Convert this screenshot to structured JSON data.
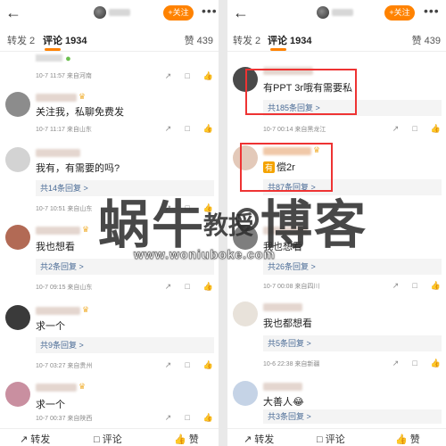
{
  "header": {
    "back_icon": "back-arrow-icon",
    "follow_label": "+关注",
    "more_icon": "more-dots-icon"
  },
  "tabs": {
    "repost": "转发 2",
    "comment": "评论 1934",
    "like": "赞 439"
  },
  "left": {
    "partial_top_meta": "10-7 11:57  来自河南",
    "comments": [
      {
        "text": "关注我，私聊免费发",
        "meta": "10-7 11:17  来自山东",
        "replies": ""
      },
      {
        "text": "我有，有需要的吗?",
        "meta": "10-7 10:51  来自山东",
        "replies": "共14条回复 >"
      },
      {
        "text": "我也想看",
        "meta": "10-7 09:15  来自山东",
        "replies": "共2条回复 >"
      },
      {
        "text": "求一个",
        "meta": "10-7 03:27  来自贵州",
        "replies": "共9条回复 >"
      },
      {
        "text": "求一个",
        "meta": "10-7 00:37  来自陕西",
        "replies": ""
      }
    ],
    "bottom": {
      "repost": "转发",
      "comment": "评论",
      "like": "赞"
    }
  },
  "right": {
    "comments": [
      {
        "text": "有PPT 3r哦有需要私",
        "meta": "10-7 00:14  来自黑龙江",
        "replies": "共185条回复 >"
      },
      {
        "tag": "有",
        "text": "偿2r",
        "meta": "",
        "replies": "共87条回复 >"
      },
      {
        "text": "我也想看",
        "meta": "10-7 00:08  来自四川",
        "replies": "共26条回复 >"
      },
      {
        "text": "我也都想看",
        "meta": "10-6 22:38  来自新疆",
        "replies": "共5条回复 >"
      },
      {
        "text": "大善人😂",
        "meta": "",
        "replies": "共3条回复 >"
      }
    ],
    "bottom": {
      "repost": "转发",
      "comment": "评论",
      "like": "赞"
    }
  },
  "watermark": {
    "left_big": "蜗牛",
    "mid": "教授",
    "right_big": "博客",
    "url": "www.woniuboke.com"
  },
  "colors": {
    "accent": "#ff8200",
    "link": "#4a6b96",
    "highlight_box": "#e33333"
  }
}
